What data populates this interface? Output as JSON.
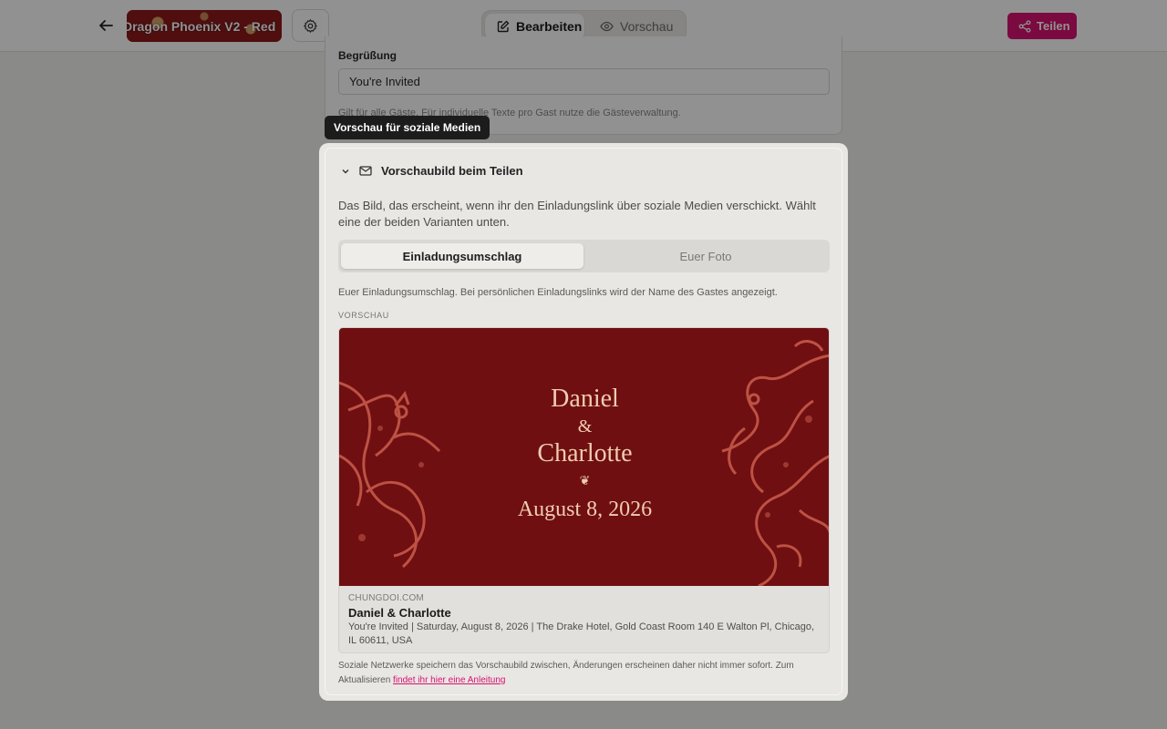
{
  "header": {
    "template_name": "Dragon Phoenix V2 - Red",
    "edit_label": "Bearbeiten",
    "preview_label": "Vorschau",
    "share_label": "Teilen",
    "accent_color": "#d6136f"
  },
  "greeting_section": {
    "label": "Begrüßung",
    "value": "You're Invited",
    "hint": "Gilt für alle Gäste. Für individuelle Texte pro Gast nutze die Gästeverwaltung."
  },
  "tooltip": "Vorschau für soziale Medien",
  "social_preview": {
    "title": "Vorschaubild beim Teilen",
    "description": "Das Bild, das erscheint, wenn ihr den Einladungslink über soziale Medien verschickt. Wählt eine der beiden Varianten unten.",
    "options": [
      "Einladungsumschlag",
      "Euer Foto"
    ],
    "selected_option": "Einladungsumschlag",
    "option_hint": "Euer Einladungsumschlag. Bei persönlichen Einladungslinks wird der Name des Gastes angezeigt.",
    "preview_heading": "VORSCHAU",
    "card": {
      "name1": "Daniel",
      "ampersand": "&",
      "name2": "Charlotte",
      "ornament": "❦",
      "date": "August 8, 2026",
      "domain": "CHUNGDOI.COM",
      "title": "Daniel & Charlotte",
      "description": "You're Invited | Saturday, August 8, 2026 | The Drake Hotel, Gold Coast Room 140 E Walton Pl, Chicago, IL 60611, USA",
      "background_color": "#6f0f11"
    },
    "footnote": "Soziale Netzwerke speichern das Vorschaubild zwischen, Änderungen erscheinen daher nicht immer sofort. Zum Aktualisieren",
    "footnote_link": "findet ihr hier eine Anleitung"
  },
  "icons": {
    "back": "arrow-left-icon",
    "dropdown": "chevron-down-icon",
    "settings": "gear-icon",
    "edit": "pencil-square-icon",
    "preview": "eye-icon",
    "share": "share-icon",
    "collapse": "chevron-down-icon",
    "mail": "mail-icon"
  }
}
